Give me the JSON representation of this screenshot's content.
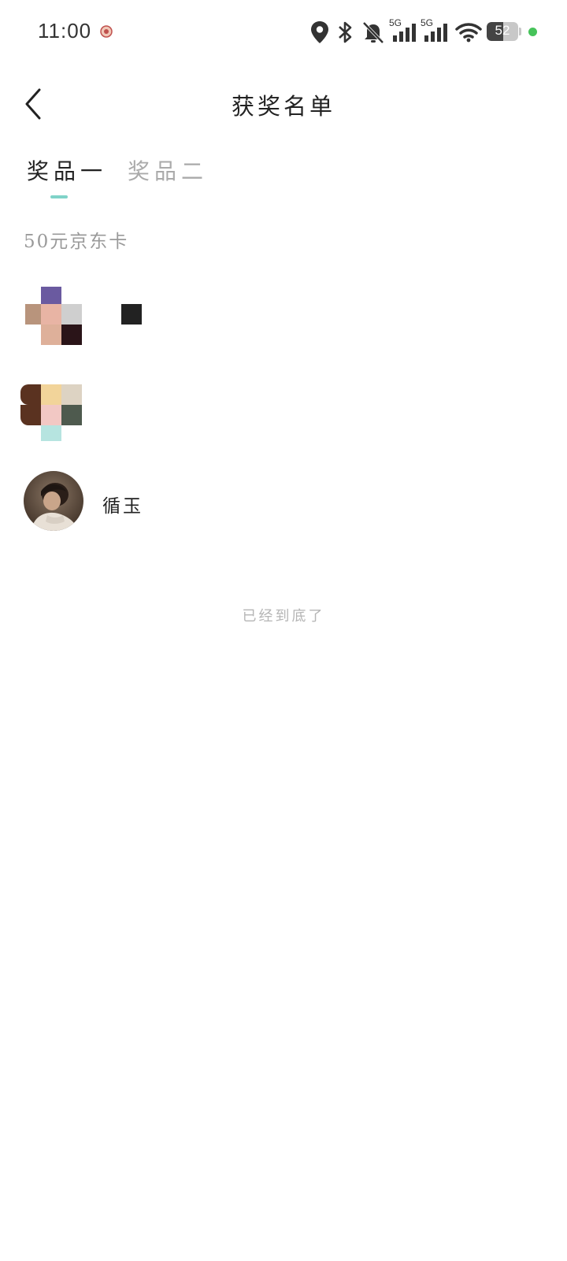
{
  "status_bar": {
    "time": "11:00",
    "battery": "52",
    "battery_level": 0.52,
    "network_labels": [
      "5G",
      "5G"
    ],
    "icons": [
      "app-notification-icon",
      "location-icon",
      "bluetooth-icon",
      "mute-icon",
      "signal-icon",
      "signal-icon",
      "wifi-icon",
      "battery-icon",
      "charging-dot"
    ]
  },
  "header": {
    "title": "获奖名单",
    "back_icon": "chevron-left-icon"
  },
  "tabs": [
    {
      "label": "奖品一",
      "active": true
    },
    {
      "label": "奖品二",
      "active": false
    }
  ],
  "prize": {
    "label": "50元京东卡"
  },
  "winners": [
    {
      "name": "",
      "avatar": "pixelated-avatar"
    },
    {
      "name": "",
      "avatar": "pixelated-avatar"
    },
    {
      "name": "循玉",
      "avatar": "photo-avatar"
    }
  ],
  "footer": {
    "end_text": "已经到底了"
  },
  "colors": {
    "accent": "#7fd3c8",
    "text_primary": "#222222",
    "text_secondary": "#9a9a9a",
    "charge_dot": "#46c35a"
  }
}
